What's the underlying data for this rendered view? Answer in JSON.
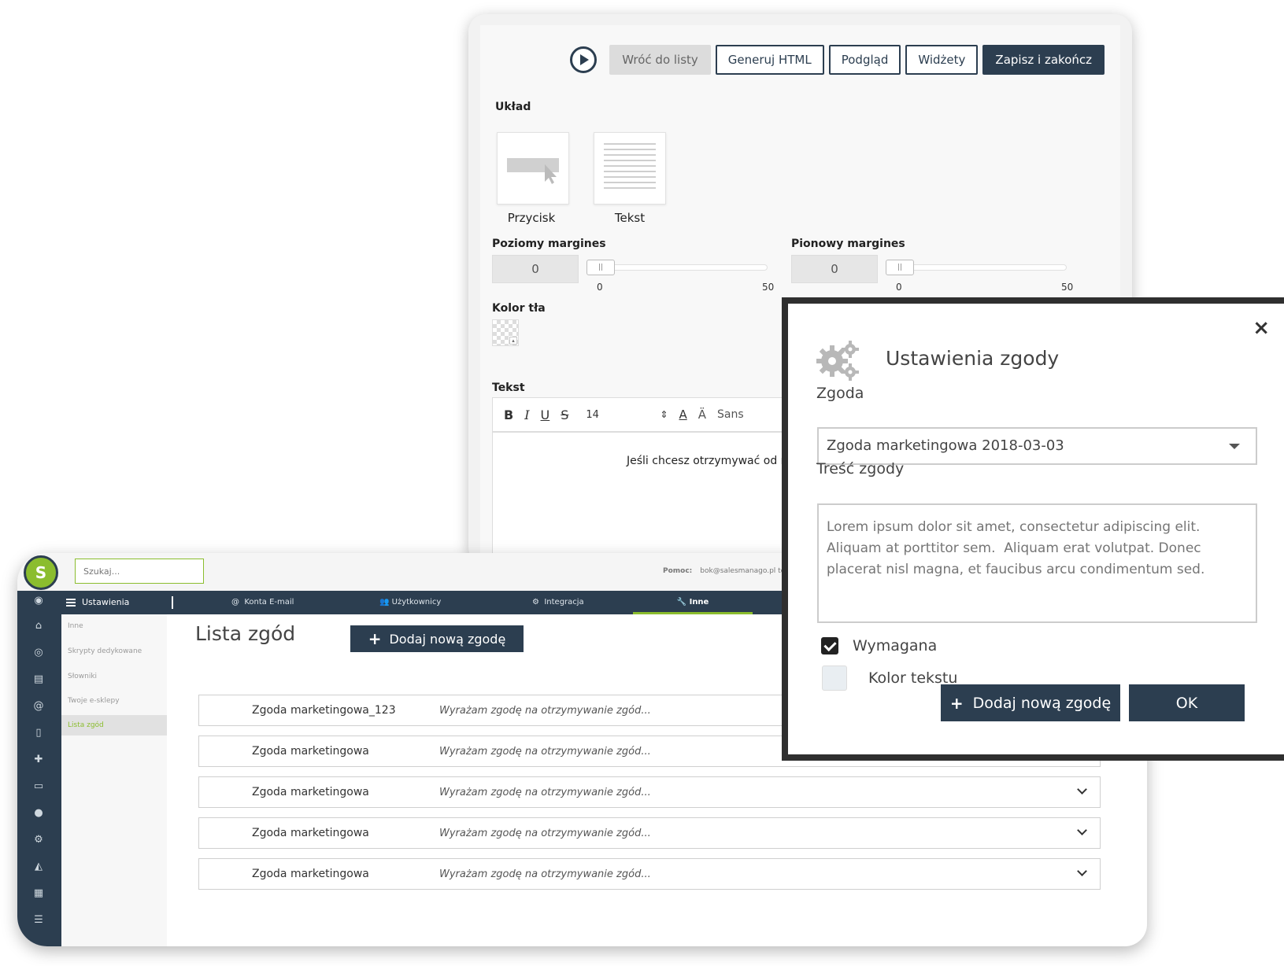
{
  "editor": {
    "toolbar": {
      "back": "Wróć do listy",
      "generate_html": "Generuj HTML",
      "preview": "Podgląd",
      "widgets": "Widżety",
      "save": "Zapisz i zakończ"
    },
    "layout_label": "Układ",
    "layout_options": [
      "Przycisk",
      "Tekst"
    ],
    "horizontal_margin": {
      "label": "Poziomy margines",
      "value": "0",
      "min": "0",
      "max": "50"
    },
    "vertical_margin": {
      "label": "Pionowy margines",
      "value": "0",
      "min": "0",
      "max": "50"
    },
    "bg_color_label": "Kolor tła",
    "text_label": "Tekst",
    "font_size": "14",
    "font_family": "Sans",
    "text_content": "Jeśli chcesz otrzymywać od n"
  },
  "app": {
    "logo": "S",
    "search_placeholder": "Szukaj...",
    "help_label": "Pomoc:",
    "help_contact": "bok@salesmanago.pl tel:",
    "nav": {
      "title": "Ustawienia",
      "items": [
        "Konta E-mail",
        "Użytkownicy",
        "Integracja",
        "Inne"
      ]
    },
    "subnav": [
      "Inne",
      "Skrypty dedykowane",
      "Słowniki",
      "Twoje e-sklepy",
      "Lista zgód"
    ],
    "page_title": "Lista zgód",
    "add_button": "Dodaj nową zgodę",
    "rows": [
      {
        "name": "Zgoda marketingowa_123",
        "desc": "Wyrażam zgodę na otrzymywanie zgód..."
      },
      {
        "name": "Zgoda marketingowa",
        "desc": "Wyrażam zgodę na otrzymywanie zgód..."
      },
      {
        "name": "Zgoda marketingowa",
        "desc": "Wyrażam zgodę na otrzymywanie zgód..."
      },
      {
        "name": "Zgoda marketingowa",
        "desc": "Wyrażam zgodę na otrzymywanie zgód..."
      },
      {
        "name": "Zgoda marketingowa",
        "desc": "Wyrażam zgodę na otrzymywanie zgód..."
      }
    ]
  },
  "modal": {
    "title": "Ustawienia zgody",
    "consent_label": "Zgoda",
    "consent_value": "Zgoda marketingowa 2018-03-03",
    "content_label": "Treść zgody",
    "content_placeholder": "Lorem ipsum dolor sit amet, consectetur adipiscing elit. Aliquam at porttitor sem.  Aliquam erat volutpat. Donec placerat nisl magna, et faucibus arcu condimentum sed.",
    "required_label": "Wymagana",
    "text_color_label": "Kolor tekstu",
    "add_button": "Dodaj nową zgodę",
    "ok_button": "OK",
    "close": "×"
  },
  "colors": {
    "primary": "#2c3e50",
    "accent": "#8bbd2e"
  }
}
